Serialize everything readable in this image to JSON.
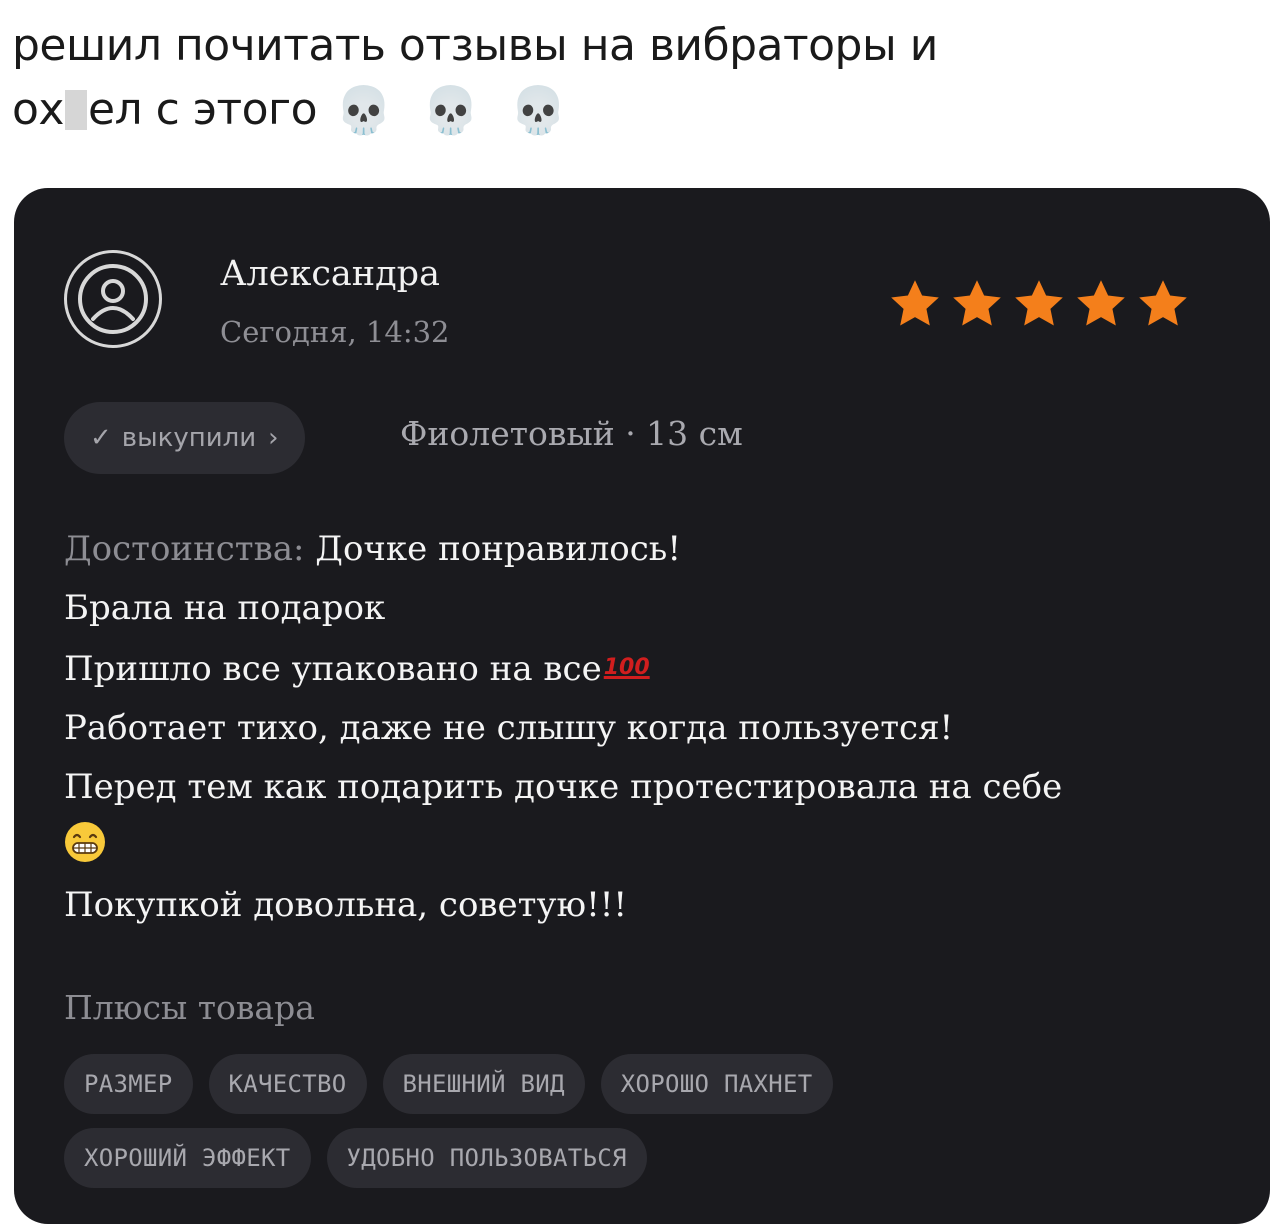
{
  "post": {
    "line1": "решил почитать отзывы на вибраторы и",
    "line2_before": "ох",
    "line2_after": "ел с этого",
    "emoji": "💀💀💀"
  },
  "review": {
    "author": "Александра",
    "date": "Сегодня, 14:32",
    "rating": 5,
    "rating_max": 5,
    "star_color": "#f47f1b",
    "purchased_label": "выкупили",
    "purchased_check": "✓",
    "purchased_chevron": "›",
    "variant": "Фиолетовый · 13 см",
    "merits_label": "Достоинства:",
    "merits_first": "Дочке понравилось!",
    "line2": "Брала на подарок",
    "line3": "Пришло все упаковано на все",
    "line3_badge": "100",
    "line4": "Работает тихо, даже не слышу когда пользуется!",
    "line5": "Перед тем как подарить дочке протестировала на себе",
    "line6_emoji": "grinning-face",
    "line7": "Покупкой довольна, советую!!!",
    "pros_heading": "Плюсы товара",
    "tags_row1": [
      "РАЗМЕР",
      "КАЧЕСТВО",
      "ВНЕШНИЙ ВИД",
      "ХОРОШО ПАХНЕТ"
    ],
    "tags_row2": [
      "ХОРОШИЙ ЭФФЕКТ",
      "УДОБНО ПОЛЬЗОВАТЬСЯ"
    ]
  }
}
